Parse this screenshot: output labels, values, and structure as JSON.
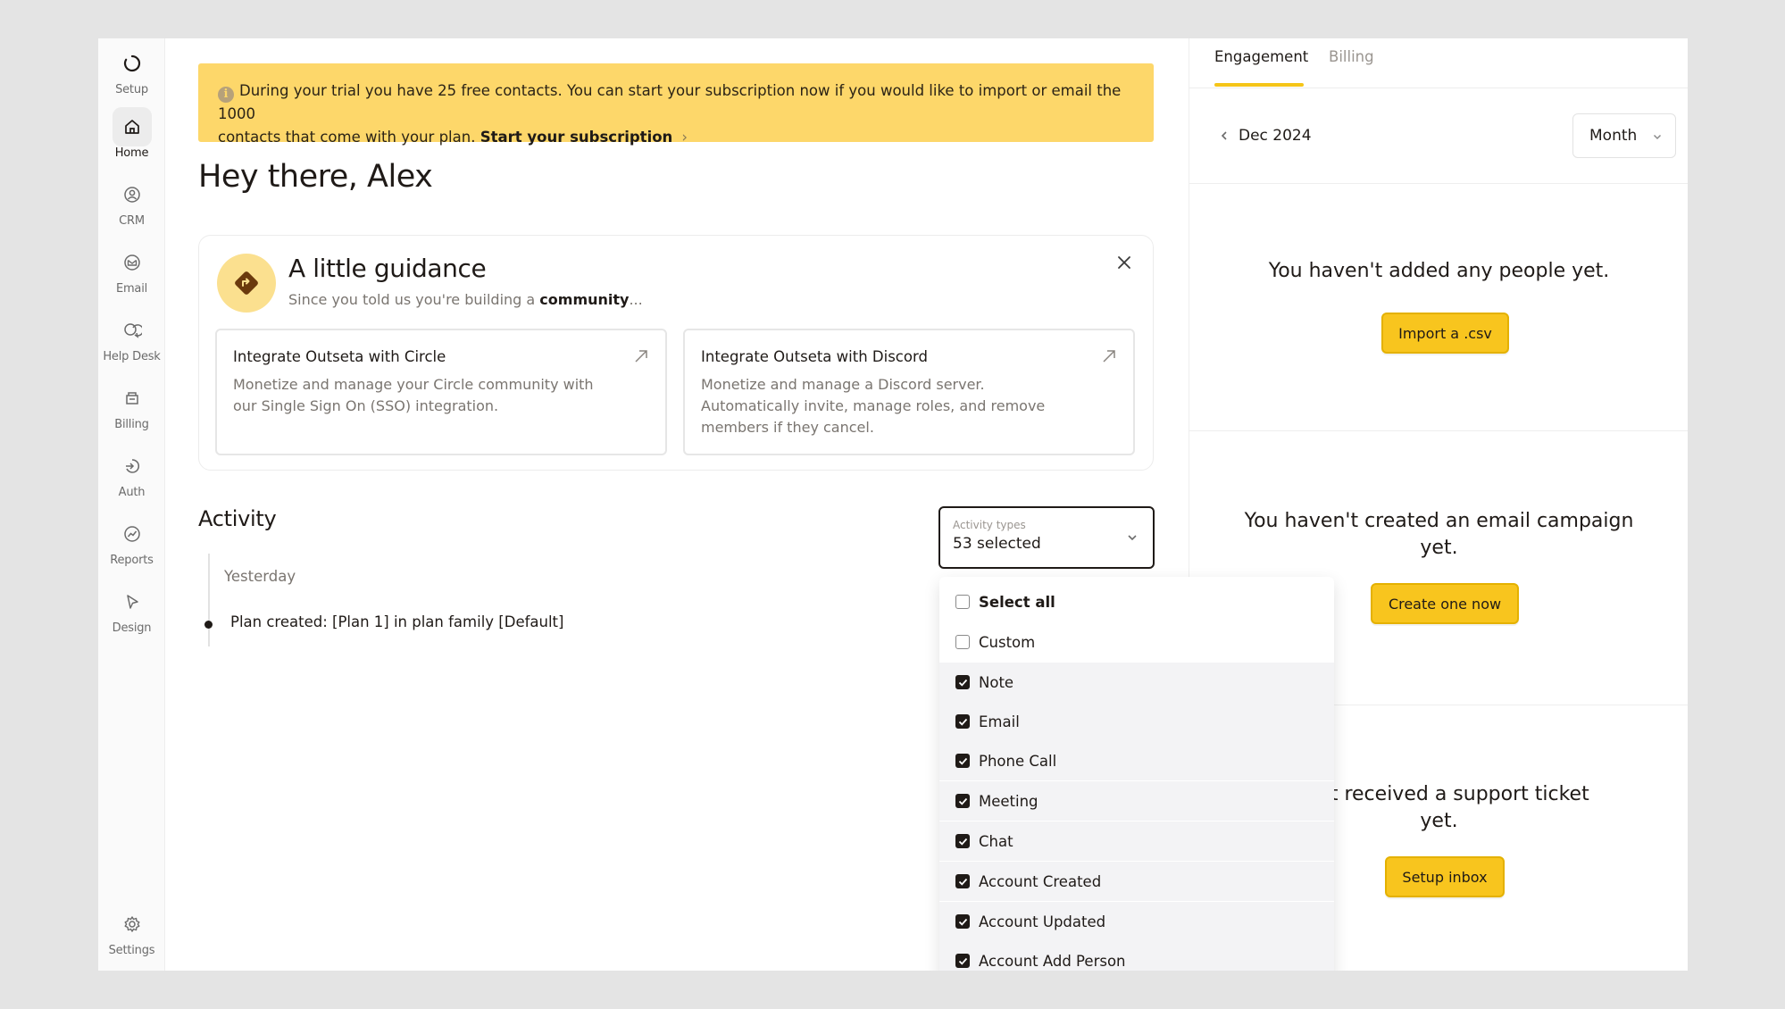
{
  "sidebar": {
    "items": [
      {
        "label": "Setup",
        "icon": "setup-ring-icon"
      },
      {
        "label": "Home",
        "icon": "home-icon"
      },
      {
        "label": "CRM",
        "icon": "crm-person-icon"
      },
      {
        "label": "Email",
        "icon": "email-icon"
      },
      {
        "label": "Help Desk",
        "icon": "help-desk-icon"
      },
      {
        "label": "Billing",
        "icon": "billing-icon"
      },
      {
        "label": "Auth",
        "icon": "auth-icon"
      },
      {
        "label": "Reports",
        "icon": "reports-icon"
      },
      {
        "label": "Design",
        "icon": "design-cursor-icon"
      }
    ],
    "settings_label": "Settings",
    "active": "Home"
  },
  "banner": {
    "text_line1": "During your trial you have 25 free contacts. You can start your subscription now if you would like to import or email the 1000",
    "text_line2": "contacts that come with your plan.",
    "link": "Start your subscription",
    "link_chevron": "›",
    "info_glyph": "i"
  },
  "greeting": "Hey there, Alex",
  "guidance": {
    "title": "A little guidance",
    "subtitle_prefix": "Since you told us you're building a",
    "subtitle_bold": "community",
    "subtitle_suffix": "...",
    "cards": [
      {
        "title": "Integrate Outseta with Circle",
        "description": "Monetize and manage your Circle community with our Single Sign On (SSO) integration."
      },
      {
        "title": "Integrate Outseta with Discord",
        "description": "Monetize and manage a Discord server. Automatically invite, manage roles, and remove members if they cancel."
      }
    ]
  },
  "activity": {
    "title": "Activity",
    "day": "Yesterday",
    "items": [
      "Plan created: [Plan 1] in plan family [Default]"
    ],
    "filter": {
      "label": "Activity types",
      "value": "53 selected"
    },
    "options": [
      {
        "label": "Select all",
        "checked": false,
        "bold": true
      },
      {
        "label": "Custom",
        "checked": false,
        "bold": false
      },
      {
        "label": "Note",
        "checked": true,
        "bold": false
      },
      {
        "label": "Email",
        "checked": true,
        "bold": false
      },
      {
        "label": "Phone Call",
        "checked": true,
        "bold": false
      },
      {
        "label": "Meeting",
        "checked": true,
        "bold": false
      },
      {
        "label": "Chat",
        "checked": true,
        "bold": false
      },
      {
        "label": "Account Created",
        "checked": true,
        "bold": false
      },
      {
        "label": "Account Updated",
        "checked": true,
        "bold": false
      },
      {
        "label": "Account Add Person",
        "checked": true,
        "bold": false
      }
    ]
  },
  "right_panel": {
    "tabs": [
      "Engagement",
      "Billing"
    ],
    "active_tab": "Engagement",
    "month": "Dec 2024",
    "period": "Month",
    "sections": [
      {
        "text": "You haven't added any people yet.",
        "button": "Import a .csv"
      },
      {
        "text_line1": "You haven't created an email campaign",
        "text_line2": "yet.",
        "button": "Create one now"
      },
      {
        "text_line1": "ven't received a support ticket",
        "text_line2": "yet.",
        "button": "Setup inbox"
      }
    ]
  },
  "colors": {
    "accent_yellow": "#f8c51e",
    "banner_yellow": "#fdd76a",
    "text_dark": "#1f1a17"
  }
}
